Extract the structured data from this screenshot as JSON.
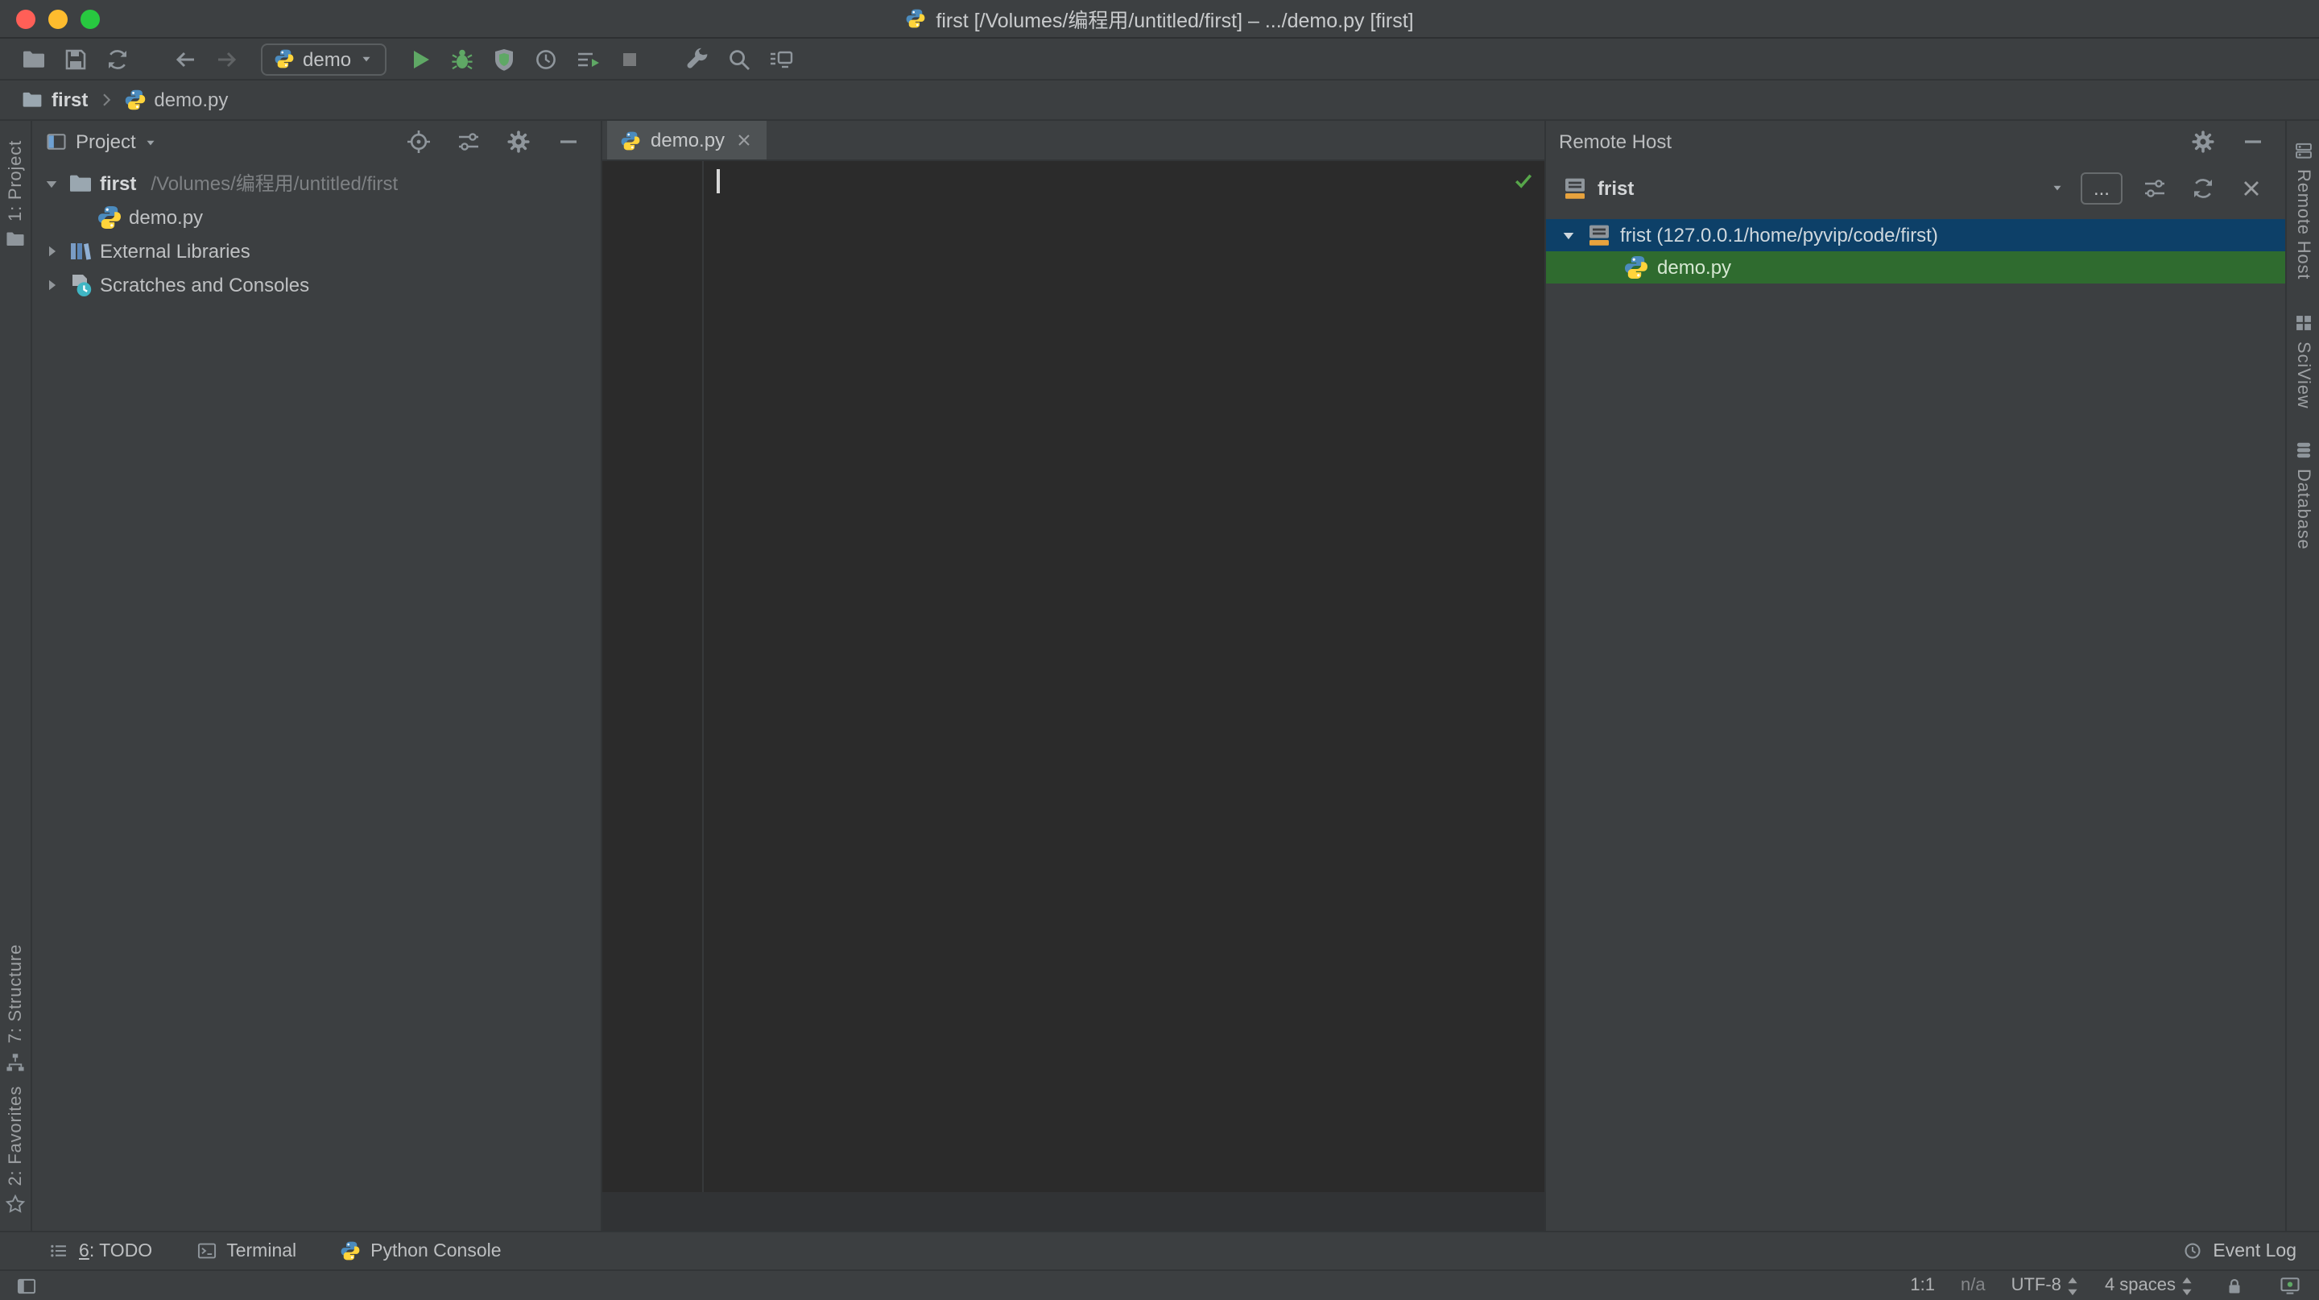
{
  "titlebar": {
    "title": "first [/Volumes/编程用/untitled/first] – .../demo.py [first]"
  },
  "toolbar": {
    "run_config_label": "demo"
  },
  "breadcrumbs": {
    "project": "first",
    "file": "demo.py"
  },
  "left_stripe": {
    "project_label": "1: Project",
    "structure_label": "7: Structure",
    "favorites_label": "2: Favorites"
  },
  "right_stripe": {
    "remote_host_label": "Remote Host",
    "sciview_label": "SciView",
    "database_label": "Database"
  },
  "project_panel": {
    "title": "Project",
    "root_name": "first",
    "root_path": "/Volumes/编程用/untitled/first",
    "file_name": "demo.py",
    "external_libraries_label": "External Libraries",
    "scratches_label": "Scratches and Consoles"
  },
  "editor": {
    "tab_label": "demo.py"
  },
  "remote_host": {
    "panel_title": "Remote Host",
    "server_combo_label": "frist",
    "browse_button_label": "...",
    "root_row_label": "frist (127.0.0.1/home/pyvip/code/first)",
    "file_row_label": "demo.py"
  },
  "bottom_bar": {
    "todo_mnemonic": "6",
    "todo_label": ": TODO",
    "terminal_label": "Terminal",
    "python_console_label": "Python Console",
    "event_log_label": "Event Log"
  },
  "status_bar": {
    "caret_position": "1:1",
    "highlight_level": "n/a",
    "encoding": "UTF-8",
    "indent": "4 spaces"
  },
  "colors": {
    "panel_bg": "#3c3f41",
    "editor_bg": "#2b2b2b",
    "selection_blue": "#0d4068",
    "transfer_green": "#2f6b2f",
    "run_green": "#5fa865"
  }
}
